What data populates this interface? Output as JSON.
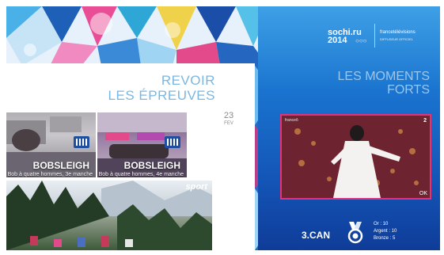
{
  "left_panel": {
    "title_line1": "REVOIR",
    "title_line2": "LES ÉPREUVES",
    "date_day": "23",
    "date_month": "FEV",
    "tiles": [
      {
        "sport": "BOBSLEIGH",
        "event": "Bob à quatre hommes, 3e manche"
      },
      {
        "sport": "BOBSLEIGH",
        "event": "Bob à quatre hommes, 4e manche"
      }
    ],
    "big_image_logo": "sport"
  },
  "right_panel": {
    "logo_line1": "sochi.ru",
    "logo_line2": "2014",
    "broadcaster": "francetélévisions",
    "broadcaster_tagline": "DIFFUSEUR OFFICIEL",
    "title_line1": "LES MOMENTS",
    "title_line2": "FORTS",
    "video": {
      "ok_label": "OK",
      "tag": "franceô",
      "channel": "2"
    },
    "country_rank": "3.CAN",
    "medals": {
      "gold": "Or : 10",
      "silver": "Argent : 10",
      "bronze": "Bronze : 5"
    }
  },
  "colors": {
    "accent_pink": "#e0337c",
    "panel_blue": "#1a74cf",
    "title_blue": "#7ab7e2"
  },
  "icons": [
    "camera-icon",
    "medal-icon",
    "olympic-rings-icon"
  ]
}
